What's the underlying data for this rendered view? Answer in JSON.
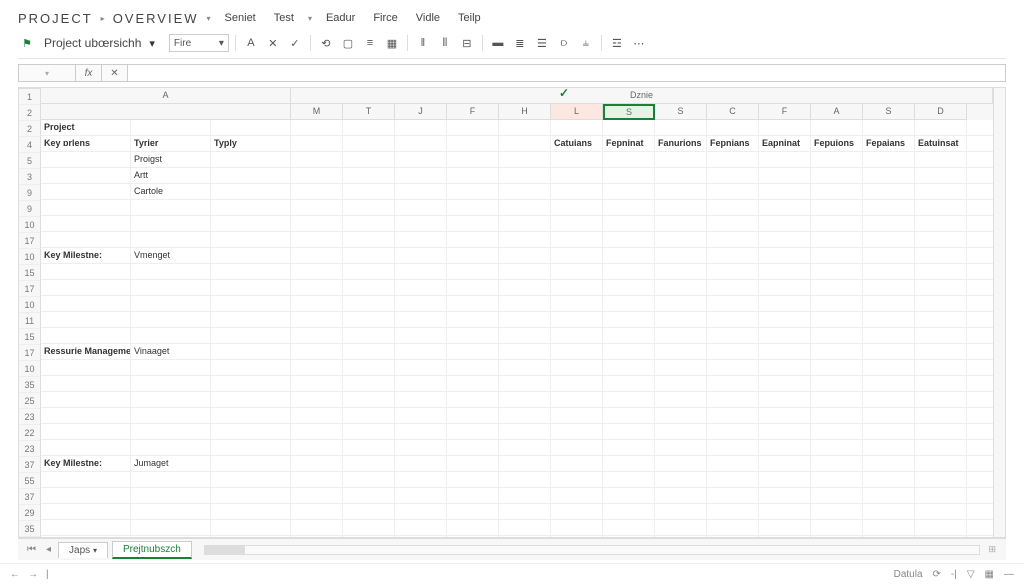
{
  "menu": {
    "title1": "PROJECT",
    "title2": "OVERVIEW",
    "items": [
      "Seniet",
      "Test",
      "Eadur",
      "Firce",
      "Vidle",
      "Teilp"
    ]
  },
  "toolbar": {
    "docname": "Project ubœrsichh",
    "font": "Fire"
  },
  "formula": {
    "cellref": "",
    "fx_label": "fx",
    "x_label": "✕"
  },
  "columns_top_merged": {
    "span_label": "Dznie"
  },
  "columns_top_a": "A",
  "columns": [
    "M",
    "T",
    "J",
    "F",
    "H",
    "L",
    "S",
    "S",
    "C",
    "F",
    "A",
    "S",
    "D"
  ],
  "selected_col_index": 6,
  "highlight_l_index": 5,
  "row_numbers": [
    "1",
    "2",
    "2",
    "4",
    "5",
    "3",
    "9",
    "9",
    "10",
    "17",
    "10",
    "15",
    "17",
    "10",
    "11",
    "15",
    "17",
    "10",
    "35",
    "25",
    "23",
    "22",
    "23",
    "37",
    "55",
    "37",
    "29",
    "35"
  ],
  "rows": [
    {
      "a": "Project",
      "bold_a": true
    },
    {
      "a": "Key ɒrlens",
      "b": "Tyrier",
      "c": "Typly",
      "bold_a": true,
      "bold_b": true,
      "bold_c": true,
      "tail": [
        "Catuians",
        "Fepninat",
        "Fanurions",
        "Fepnians",
        "Eapninat",
        "Fepuions",
        "Fepaians",
        "Eatuinsat"
      ],
      "tail_bold": true
    },
    {
      "b": "Proigst"
    },
    {
      "b": "Artt"
    },
    {
      "b": "Cartole"
    },
    {},
    {},
    {},
    {
      "a": "Key Milestne:",
      "b": "Vmenget",
      "bold_a": true
    },
    {},
    {},
    {},
    {},
    {},
    {
      "a": "Ressurie Managemet",
      "b": "Vinaaget",
      "bold_a": true
    },
    {},
    {},
    {},
    {},
    {},
    {},
    {
      "a": "Key Milestne:",
      "b": "Jumaget",
      "bold_a": true
    },
    {},
    {},
    {},
    {},
    {},
    {}
  ],
  "tabs": {
    "items": [
      "Japs",
      "Prejtnubszch"
    ],
    "active": 1
  },
  "status": {
    "right_label": "Datula",
    "right_pct": "-|"
  }
}
